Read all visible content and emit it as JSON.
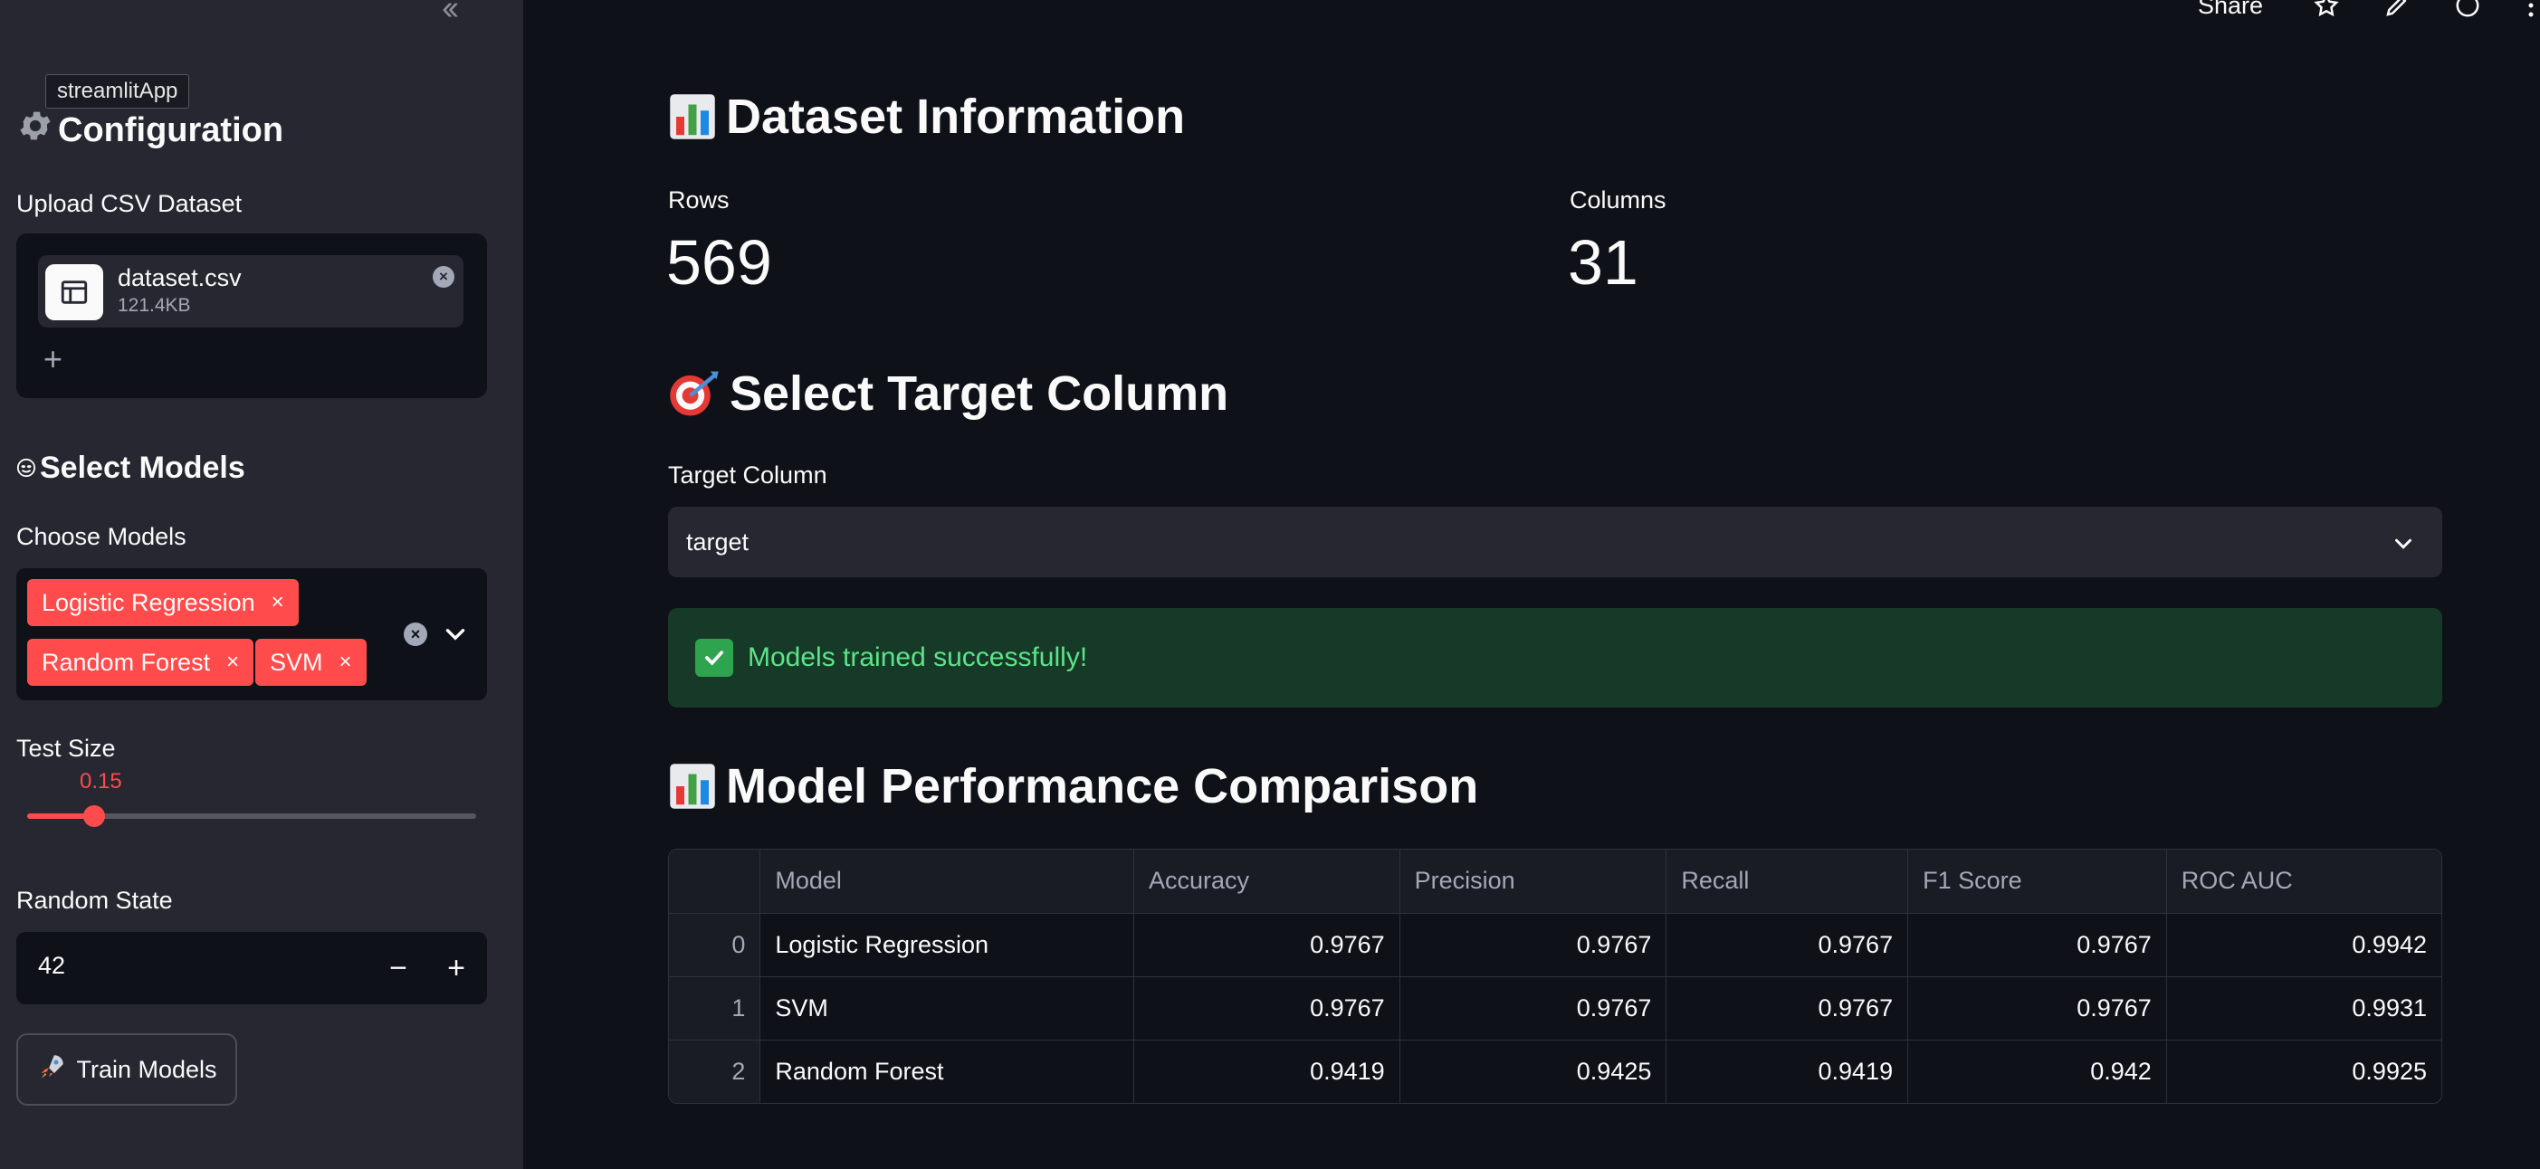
{
  "sidebar": {
    "tooltip": "streamlitApp",
    "configuration_title": "Configuration",
    "upload_label": "Upload CSV Dataset",
    "file": {
      "name": "dataset.csv",
      "size": "121.4KB"
    },
    "select_models_title": "Select Models",
    "choose_models_label": "Choose Models",
    "selected_models": [
      "Logistic Regression",
      "Random Forest",
      "SVM"
    ],
    "test_size_label": "Test Size",
    "test_size_value": "0.15",
    "test_size_range": [
      0.0,
      1.0
    ],
    "random_state_label": "Random State",
    "random_state_value": "42",
    "train_button": "Train Models"
  },
  "header": {
    "share": "Share"
  },
  "main": {
    "dataset_title": "Dataset Information",
    "rows_label": "Rows",
    "rows_value": "569",
    "columns_label": "Columns",
    "columns_value": "31",
    "target_title": "Select Target Column",
    "target_label": "Target Column",
    "target_value": "target",
    "success_message": "Models trained successfully!",
    "comparison_title": "Model Performance Comparison",
    "table": {
      "columns": [
        "",
        "Model",
        "Accuracy",
        "Precision",
        "Recall",
        "F1 Score",
        "ROC AUC"
      ],
      "rows": [
        [
          "0",
          "Logistic Regression",
          "0.9767",
          "0.9767",
          "0.9767",
          "0.9767",
          "0.9942"
        ],
        [
          "1",
          "SVM",
          "0.9767",
          "0.9767",
          "0.9767",
          "0.9767",
          "0.9931"
        ],
        [
          "2",
          "Random Forest",
          "0.9419",
          "0.9425",
          "0.9419",
          "0.942",
          "0.9925"
        ]
      ]
    }
  },
  "colors": {
    "accent": "#ff4b4b",
    "success_bg": "#173928",
    "success_text": "#5ce488"
  }
}
